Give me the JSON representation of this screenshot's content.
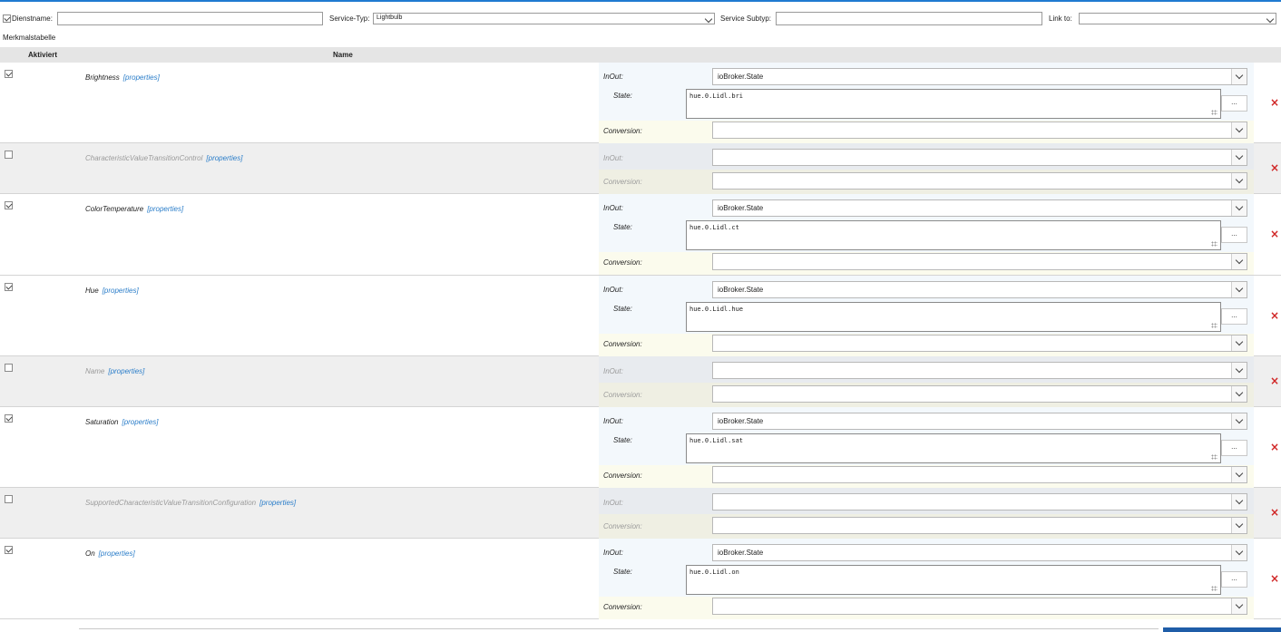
{
  "toolbar": {
    "service_name_label": "Dienstname:",
    "service_name_value": "",
    "service_type_label": "Service-Typ:",
    "service_type_value": "Lightbulb",
    "service_subtype_label": "Service Subtyp:",
    "service_subtype_value": "",
    "link_to_label": "Link to:",
    "link_to_value": ""
  },
  "table": {
    "caption": "Merkmalstabelle",
    "headers": {
      "active": "Aktiviert",
      "name": "Name"
    },
    "properties_link": "[properties]",
    "field_labels": {
      "inout": "InOut:",
      "state": "State:",
      "conversion": "Conversion:"
    },
    "dots_label": "...",
    "delete_icon": "×",
    "rows": [
      {
        "name": "Brightness",
        "active": true,
        "inout": "ioBroker.State",
        "state": "hue.0.Lidl.bri",
        "conversion": ""
      },
      {
        "name": "CharacteristicValueTransitionControl",
        "active": false,
        "inout": "",
        "conversion": ""
      },
      {
        "name": "ColorTemperature",
        "active": true,
        "inout": "ioBroker.State",
        "state": "hue.0.Lidl.ct",
        "conversion": ""
      },
      {
        "name": "Hue",
        "active": true,
        "inout": "ioBroker.State",
        "state": "hue.0.Lidl.hue",
        "conversion": ""
      },
      {
        "name": "Name",
        "active": false,
        "inout": "",
        "conversion": ""
      },
      {
        "name": "Saturation",
        "active": true,
        "inout": "ioBroker.State",
        "state": "hue.0.Lidl.sat",
        "conversion": ""
      },
      {
        "name": "SupportedCharacteristicValueTransitionConfiguration",
        "active": false,
        "inout": "",
        "conversion": ""
      },
      {
        "name": "On",
        "active": true,
        "inout": "ioBroker.State",
        "state": "hue.0.Lidl.on",
        "conversion": ""
      }
    ]
  },
  "colors": {
    "accent": "#1f7bd1",
    "delete": "#d02525",
    "link": "#2a7dc9"
  }
}
